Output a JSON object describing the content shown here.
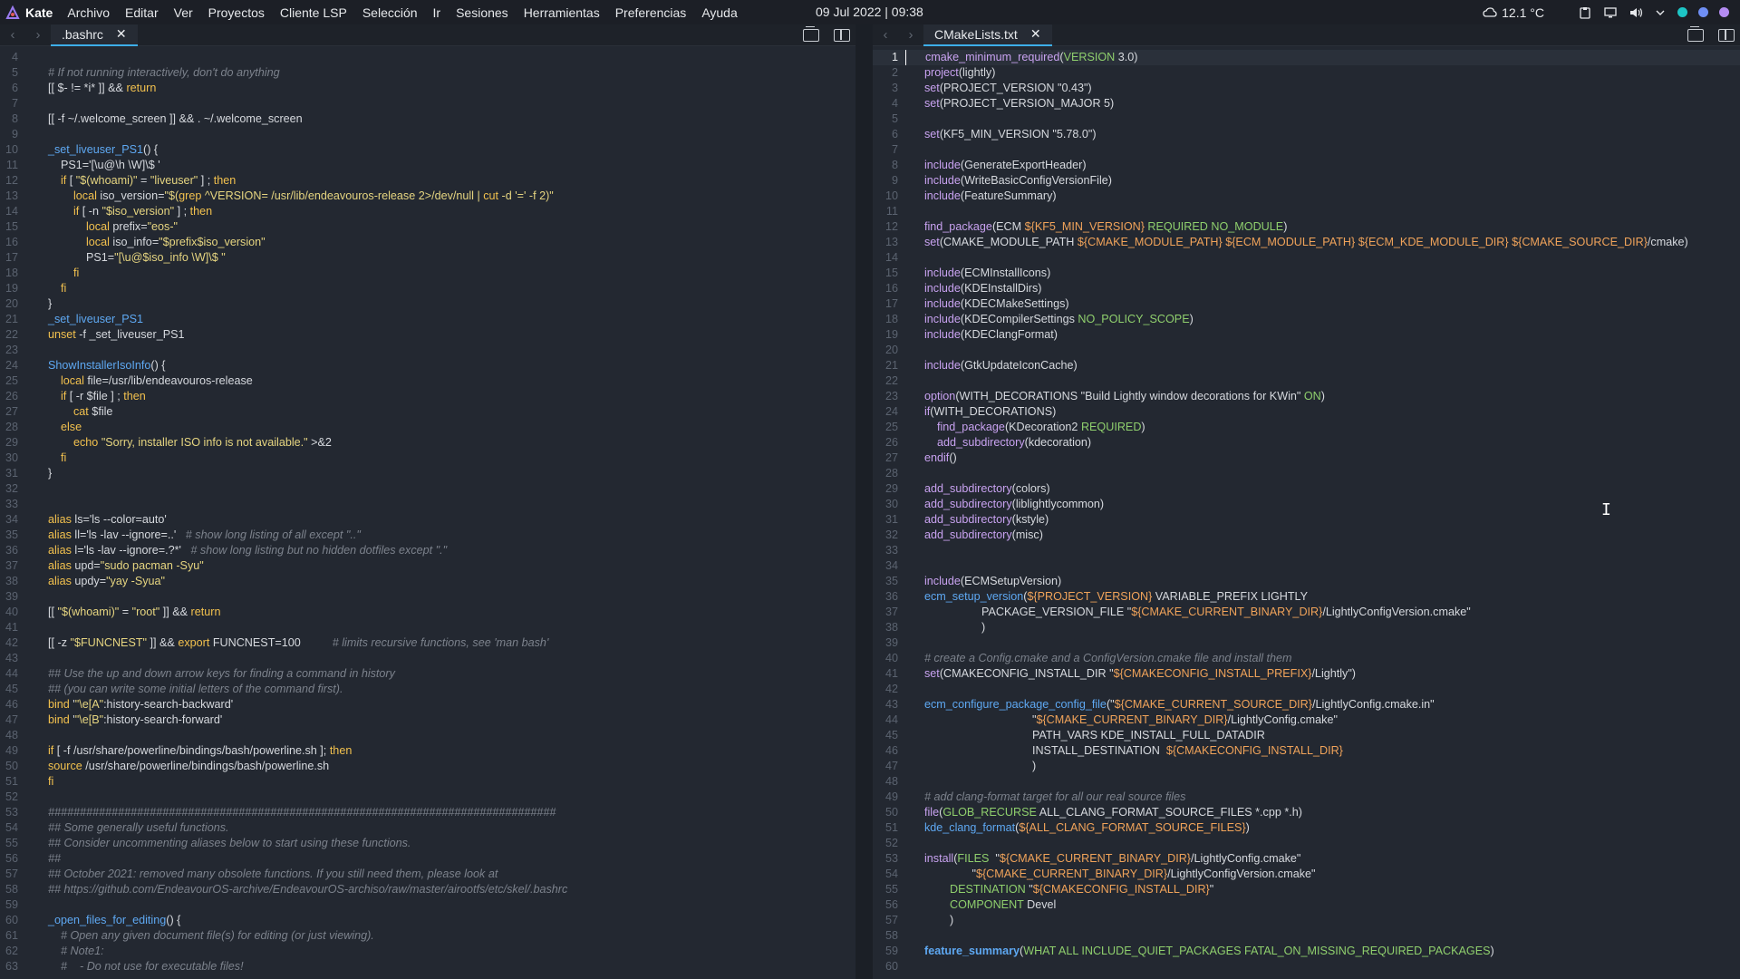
{
  "top_panel": {
    "app_name": "Kate",
    "menu": [
      "Archivo",
      "Editar",
      "Ver",
      "Proyectos",
      "Cliente LSP",
      "Selección",
      "Ir",
      "Sesiones",
      "Herramientas",
      "Preferencias",
      "Ayuda"
    ],
    "clock": "09 Jul 2022 | 09:38",
    "weather": "12.1 °C",
    "tray_dot_colors": [
      "#1dc6c6",
      "#6f8ff5",
      "#b48cf2"
    ]
  },
  "left_pane": {
    "tab_title": ".bashrc",
    "first_line": 4,
    "lines": [
      "",
      "# If not running interactively, don't do anything",
      "[[ $- != *i* ]] && return",
      "",
      "[[ -f ~/.welcome_screen ]] && . ~/.welcome_screen",
      "",
      "_set_liveuser_PS1() {",
      "    PS1='[\\u@\\h \\W]\\$ '",
      "    if [ \"$(whoami)\" = \"liveuser\" ] ; then",
      "        local iso_version=\"$(grep ^VERSION= /usr/lib/endeavouros-release 2>/dev/null | cut -d '=' -f 2)\"",
      "        if [ -n \"$iso_version\" ] ; then",
      "            local prefix=\"eos-\"",
      "            local iso_info=\"$prefix$iso_version\"",
      "            PS1=\"[\\u@$iso_info \\W]\\$ \"",
      "        fi",
      "    fi",
      "}",
      "_set_liveuser_PS1",
      "unset -f _set_liveuser_PS1",
      "",
      "ShowInstallerIsoInfo() {",
      "    local file=/usr/lib/endeavouros-release",
      "    if [ -r $file ] ; then",
      "        cat $file",
      "    else",
      "        echo \"Sorry, installer ISO info is not available.\" >&2",
      "    fi",
      "}",
      "",
      "",
      "alias ls='ls --color=auto'",
      "alias ll='ls -lav --ignore=..'   # show long listing of all except \"..\"",
      "alias l='ls -lav --ignore=.?*'   # show long listing but no hidden dotfiles except \".\"",
      "alias upd=\"sudo pacman -Syu\"",
      "alias updy=\"yay -Syua\"",
      "",
      "[[ \"$(whoami)\" = \"root\" ]] && return",
      "",
      "[[ -z \"$FUNCNEST\" ]] && export FUNCNEST=100          # limits recursive functions, see 'man bash'",
      "",
      "## Use the up and down arrow keys for finding a command in history",
      "## (you can write some initial letters of the command first).",
      "bind '\"\\e[A\":history-search-backward'",
      "bind '\"\\e[B\":history-search-forward'",
      "",
      "if [ -f /usr/share/powerline/bindings/bash/powerline.sh ]; then",
      "source /usr/share/powerline/bindings/bash/powerline.sh",
      "fi",
      "",
      "################################################################################",
      "## Some generally useful functions.",
      "## Consider uncommenting aliases below to start using these functions.",
      "##",
      "## October 2021: removed many obsolete functions. If you still need them, please look at",
      "## https://github.com/EndeavourOS-archive/EndeavourOS-archiso/raw/master/airootfs/etc/skel/.bashrc",
      "",
      "_open_files_for_editing() {",
      "    # Open any given document file(s) for editing (or just viewing).",
      "    # Note1:",
      "    #    - Do not use for executable files!"
    ]
  },
  "right_pane": {
    "tab_title": "CMakeLists.txt",
    "first_line": 1,
    "lines": [
      "cmake_minimum_required(VERSION 3.0)",
      "project(lightly)",
      "set(PROJECT_VERSION \"0.43\")",
      "set(PROJECT_VERSION_MAJOR 5)",
      "",
      "set(KF5_MIN_VERSION \"5.78.0\")",
      "",
      "include(GenerateExportHeader)",
      "include(WriteBasicConfigVersionFile)",
      "include(FeatureSummary)",
      "",
      "find_package(ECM ${KF5_MIN_VERSION} REQUIRED NO_MODULE)",
      "set(CMAKE_MODULE_PATH ${CMAKE_MODULE_PATH} ${ECM_MODULE_PATH} ${ECM_KDE_MODULE_DIR} ${CMAKE_SOURCE_DIR}/cmake)",
      "",
      "include(ECMInstallIcons)",
      "include(KDEInstallDirs)",
      "include(KDECMakeSettings)",
      "include(KDECompilerSettings NO_POLICY_SCOPE)",
      "include(KDEClangFormat)",
      "",
      "include(GtkUpdateIconCache)",
      "",
      "option(WITH_DECORATIONS \"Build Lightly window decorations for KWin\" ON)",
      "if(WITH_DECORATIONS)",
      "    find_package(KDecoration2 REQUIRED)",
      "    add_subdirectory(kdecoration)",
      "endif()",
      "",
      "add_subdirectory(colors)",
      "add_subdirectory(liblightlycommon)",
      "add_subdirectory(kstyle)",
      "add_subdirectory(misc)",
      "",
      "",
      "include(ECMSetupVersion)",
      "ecm_setup_version(${PROJECT_VERSION} VARIABLE_PREFIX LIGHTLY",
      "                  PACKAGE_VERSION_FILE \"${CMAKE_CURRENT_BINARY_DIR}/LightlyConfigVersion.cmake\"",
      "                  )",
      "",
      "# create a Config.cmake and a ConfigVersion.cmake file and install them",
      "set(CMAKECONFIG_INSTALL_DIR \"${CMAKECONFIG_INSTALL_PREFIX}/Lightly\")",
      "",
      "ecm_configure_package_config_file(\"${CMAKE_CURRENT_SOURCE_DIR}/LightlyConfig.cmake.in\"",
      "                                  \"${CMAKE_CURRENT_BINARY_DIR}/LightlyConfig.cmake\"",
      "                                  PATH_VARS KDE_INSTALL_FULL_DATADIR",
      "                                  INSTALL_DESTINATION  ${CMAKECONFIG_INSTALL_DIR}",
      "                                  )",
      "",
      "# add clang-format target for all our real source files",
      "file(GLOB_RECURSE ALL_CLANG_FORMAT_SOURCE_FILES *.cpp *.h)",
      "kde_clang_format(${ALL_CLANG_FORMAT_SOURCE_FILES})",
      "",
      "install(FILES  \"${CMAKE_CURRENT_BINARY_DIR}/LightlyConfig.cmake\"",
      "               \"${CMAKE_CURRENT_BINARY_DIR}/LightlyConfigVersion.cmake\"",
      "        DESTINATION \"${CMAKECONFIG_INSTALL_DIR}\"",
      "        COMPONENT Devel",
      "        )",
      "",
      "feature_summary(WHAT ALL INCLUDE_QUIET_PACKAGES FATAL_ON_MISSING_REQUIRED_PACKAGES)",
      ""
    ]
  }
}
